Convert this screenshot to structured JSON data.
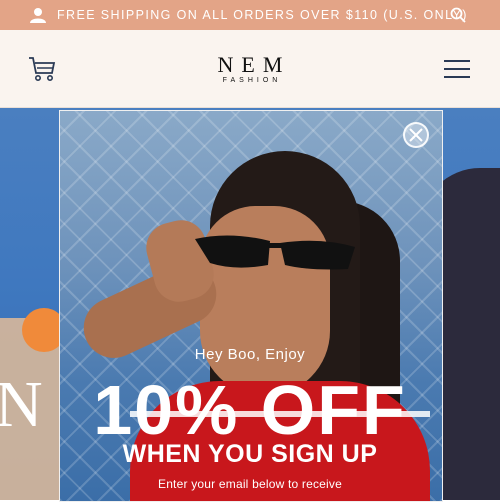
{
  "topbar": {
    "promo": "FREE SHIPPING ON ALL ORDERS OVER $110 (U.S. ONLY)",
    "background": "#e3a487",
    "icons": [
      "user-icon",
      "search-icon"
    ]
  },
  "header": {
    "logo_main": "NEM",
    "logo_sub": "FASHION",
    "icons": [
      "cart-icon",
      "menu-icon"
    ]
  },
  "hero": {
    "big_text": "N           ES"
  },
  "popup": {
    "greeting": "Hey Boo, Enjoy",
    "discount": "10% OFF",
    "signup": "WHEN YOU SIGN UP",
    "subtext": "Enter your email below to receive",
    "close_icon": "close-icon",
    "accent": "#c8171c"
  }
}
